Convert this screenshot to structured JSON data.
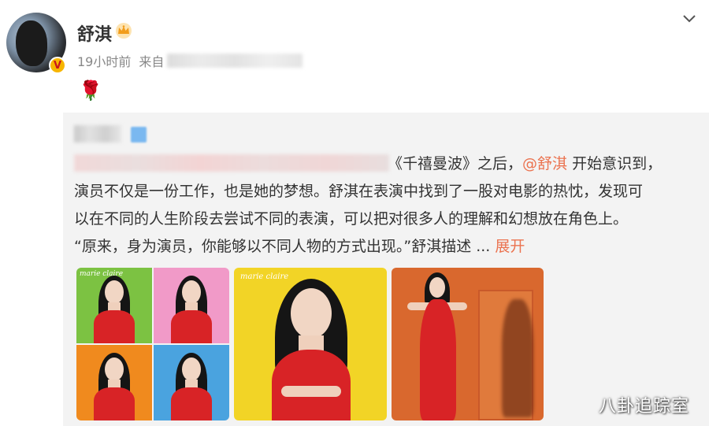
{
  "post": {
    "user_name": "舒淇",
    "verified_badge": "V",
    "time": "19小时前",
    "source_label": "来自",
    "emoji": "🌹"
  },
  "repost": {
    "line1_visible": "《千禧曼波》之后，",
    "mention": "@舒淇",
    "line1_rest": " 开始意识到，",
    "line2": "演员不仅是一份工作，也是她的梦想。舒淇在表演中找到了一股对电影的热忱，发现可",
    "line3": "以在不同的人生阶段去尝试不同的表演，可以把对很多人的理解和幻想放在角色上。",
    "line4": "“原来，身为演员，你能够以不同人物的方式出现。”舒淇描述  ... ",
    "expand": "展开"
  },
  "images": {
    "magazine_logo": "marie claire"
  },
  "watermark": "八卦追踪室",
  "colors": {
    "link": "#eb7350",
    "repost_bg": "#f3f3f3",
    "dress": "#d82326"
  },
  "icons": [
    "chevron-down-icon",
    "crown-icon",
    "rose-icon",
    "verified-badge-icon"
  ]
}
